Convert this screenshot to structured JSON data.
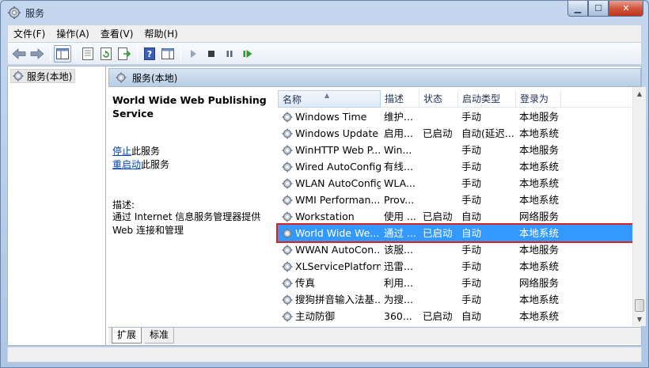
{
  "window": {
    "title": "服务"
  },
  "menu": [
    "文件(F)",
    "操作(A)",
    "查看(V)",
    "帮助(H)"
  ],
  "tree": {
    "root_label": "服务(本地)"
  },
  "pane": {
    "header": "服务(本地)"
  },
  "detail": {
    "service_name": "World Wide Web Publishing Service",
    "action_stop_link": "停止",
    "action_stop_suffix": "此服务",
    "action_restart_link": "重启动",
    "action_restart_suffix": "此服务",
    "description_label": "描述:",
    "description_text": "通过 Internet 信息服务管理器提供 Web 连接和管理"
  },
  "columns": {
    "name": "名称",
    "desc": "描述",
    "status": "状态",
    "startup": "启动类型",
    "logon": "登录为"
  },
  "services": [
    {
      "name": "Windows Time",
      "desc": "维护...",
      "status": "",
      "startup": "手动",
      "logon": "本地服务"
    },
    {
      "name": "Windows Update",
      "desc": "启用...",
      "status": "已启动",
      "startup": "自动(延迟...",
      "logon": "本地系统"
    },
    {
      "name": "WinHTTP Web P...",
      "desc": "Win...",
      "status": "",
      "startup": "手动",
      "logon": "本地服务"
    },
    {
      "name": "Wired AutoConfig",
      "desc": "有线...",
      "status": "",
      "startup": "手动",
      "logon": "本地系统"
    },
    {
      "name": "WLAN AutoConfig",
      "desc": "WLA...",
      "status": "",
      "startup": "手动",
      "logon": "本地系统"
    },
    {
      "name": "WMI Performan...",
      "desc": "Prov...",
      "status": "",
      "startup": "手动",
      "logon": "本地系统"
    },
    {
      "name": "Workstation",
      "desc": "使用 ...",
      "status": "已启动",
      "startup": "自动",
      "logon": "网络服务"
    },
    {
      "name": "World Wide We...",
      "desc": "通过 ...",
      "status": "已启动",
      "startup": "自动",
      "logon": "本地系统",
      "selected": true
    },
    {
      "name": "WWAN AutoCon...",
      "desc": "该服...",
      "status": "",
      "startup": "手动",
      "logon": "本地服务"
    },
    {
      "name": "XLServicePlatform",
      "desc": "迅雷...",
      "status": "",
      "startup": "手动",
      "logon": "本地系统"
    },
    {
      "name": "传真",
      "desc": "利用...",
      "status": "",
      "startup": "手动",
      "logon": "网络服务"
    },
    {
      "name": "搜狗拼音输入法基...",
      "desc": "为搜...",
      "status": "",
      "startup": "手动",
      "logon": "本地系统"
    },
    {
      "name": "主动防御",
      "desc": "360...",
      "status": "已启动",
      "startup": "自动",
      "logon": "本地系统"
    }
  ],
  "tabs": {
    "extended": "扩展",
    "standard": "标准"
  },
  "colors": {
    "selection": "#3399ff",
    "highlight_box": "#e02020",
    "link": "#0645ad"
  }
}
